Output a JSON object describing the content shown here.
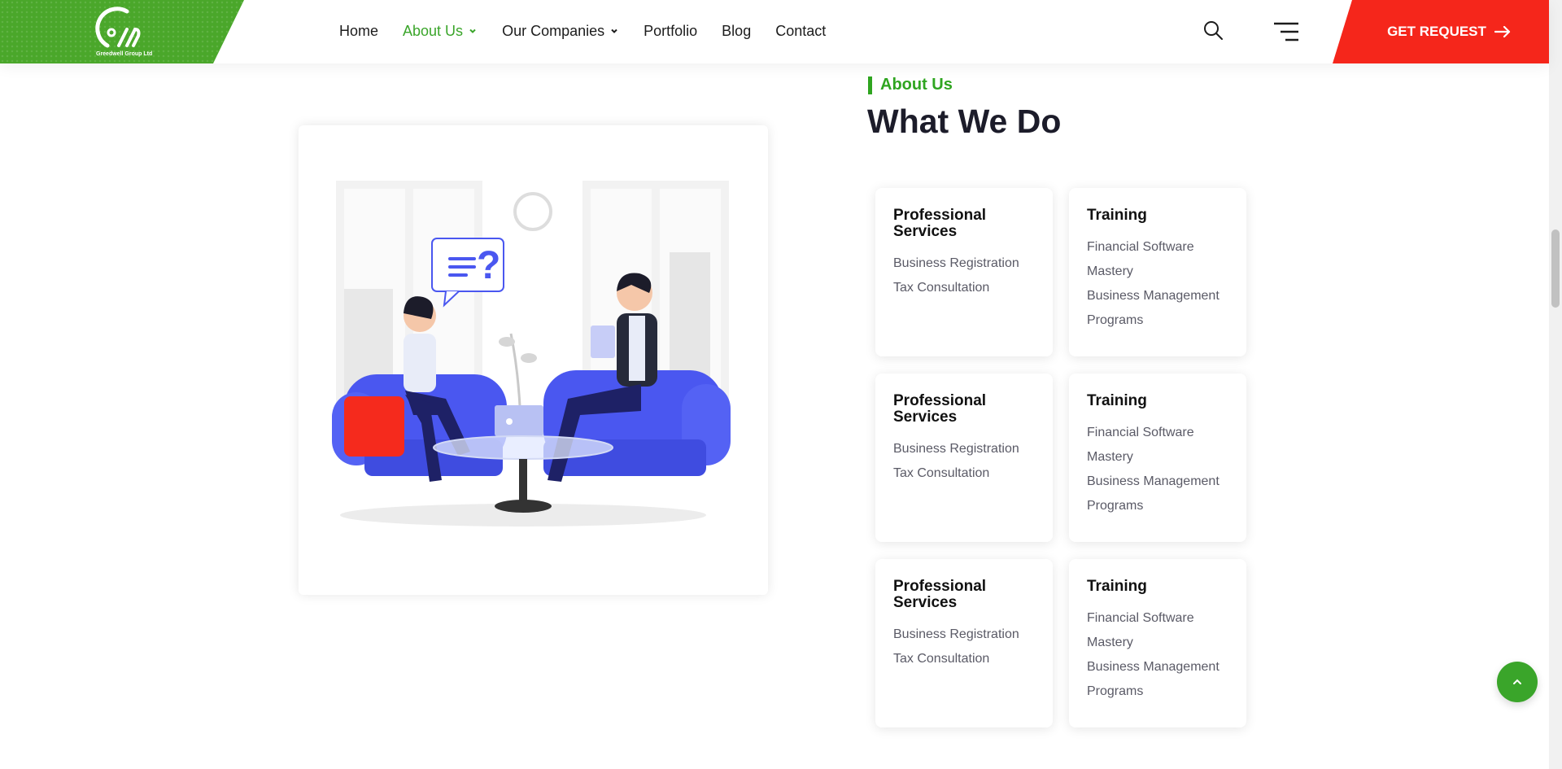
{
  "header": {
    "logo_text": "Greedwell Group Ltd",
    "nav": [
      {
        "label": "Home",
        "active": false,
        "has_dropdown": false
      },
      {
        "label": "About Us",
        "active": true,
        "has_dropdown": true
      },
      {
        "label": "Our Companies",
        "active": false,
        "has_dropdown": true
      },
      {
        "label": "Portfolio",
        "active": false,
        "has_dropdown": false
      },
      {
        "label": "Blog",
        "active": false,
        "has_dropdown": false
      },
      {
        "label": "Contact",
        "active": false,
        "has_dropdown": false
      }
    ],
    "cta_label": "GET REQUEST"
  },
  "section": {
    "eyebrow": "About Us",
    "title": "What We Do"
  },
  "cards": [
    {
      "title": "Professional Services",
      "items": [
        "Business Registration",
        "Tax Consultation"
      ]
    },
    {
      "title": "Training",
      "items": [
        "Financial Software Mastery",
        "Business Management Programs"
      ]
    },
    {
      "title": "Professional Services",
      "items": [
        "Business Registration",
        "Tax Consultation"
      ]
    },
    {
      "title": "Training",
      "items": [
        "Financial Software Mastery",
        "Business Management Programs"
      ]
    },
    {
      "title": "Professional Services",
      "items": [
        "Business Registration",
        "Tax Consultation"
      ]
    },
    {
      "title": "Training",
      "items": [
        "Financial Software Mastery",
        "Business Management Programs"
      ]
    }
  ],
  "colors": {
    "brand_green": "#3aa52a",
    "accent_red": "#f5261b",
    "sofa_blue": "#4a57f0"
  },
  "icons": [
    "search-icon",
    "menu-icon",
    "arrow-right-icon",
    "chevron-down-icon",
    "chevron-up-icon"
  ]
}
